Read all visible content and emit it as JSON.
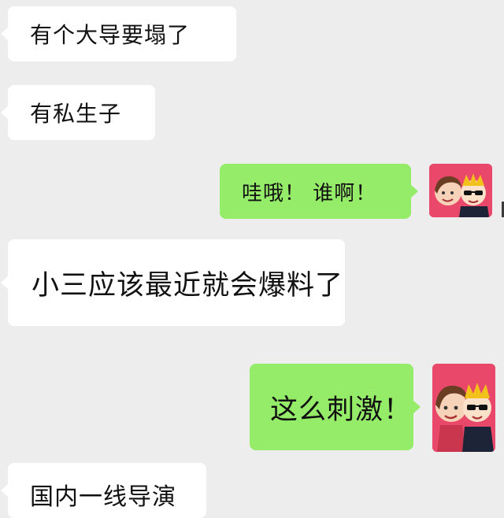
{
  "chat": {
    "messages": [
      {
        "side": "left",
        "text": "有个大导要塌了"
      },
      {
        "side": "left",
        "text": "有私生子"
      },
      {
        "side": "right",
        "text": "哇哦！ 谁啊！"
      },
      {
        "side": "left",
        "text": "小三应该最近就会爆料了"
      },
      {
        "side": "right",
        "text": "这么刺激！"
      },
      {
        "side": "left",
        "text": "国内一线导演"
      }
    ]
  },
  "avatars": {
    "self_icon": "cartoon-couple-icon"
  },
  "colors": {
    "background": "#ededed",
    "left_bubble": "#ffffff",
    "right_bubble": "#95ec69",
    "avatar_bg": "#e9486a",
    "text": "#111111"
  }
}
